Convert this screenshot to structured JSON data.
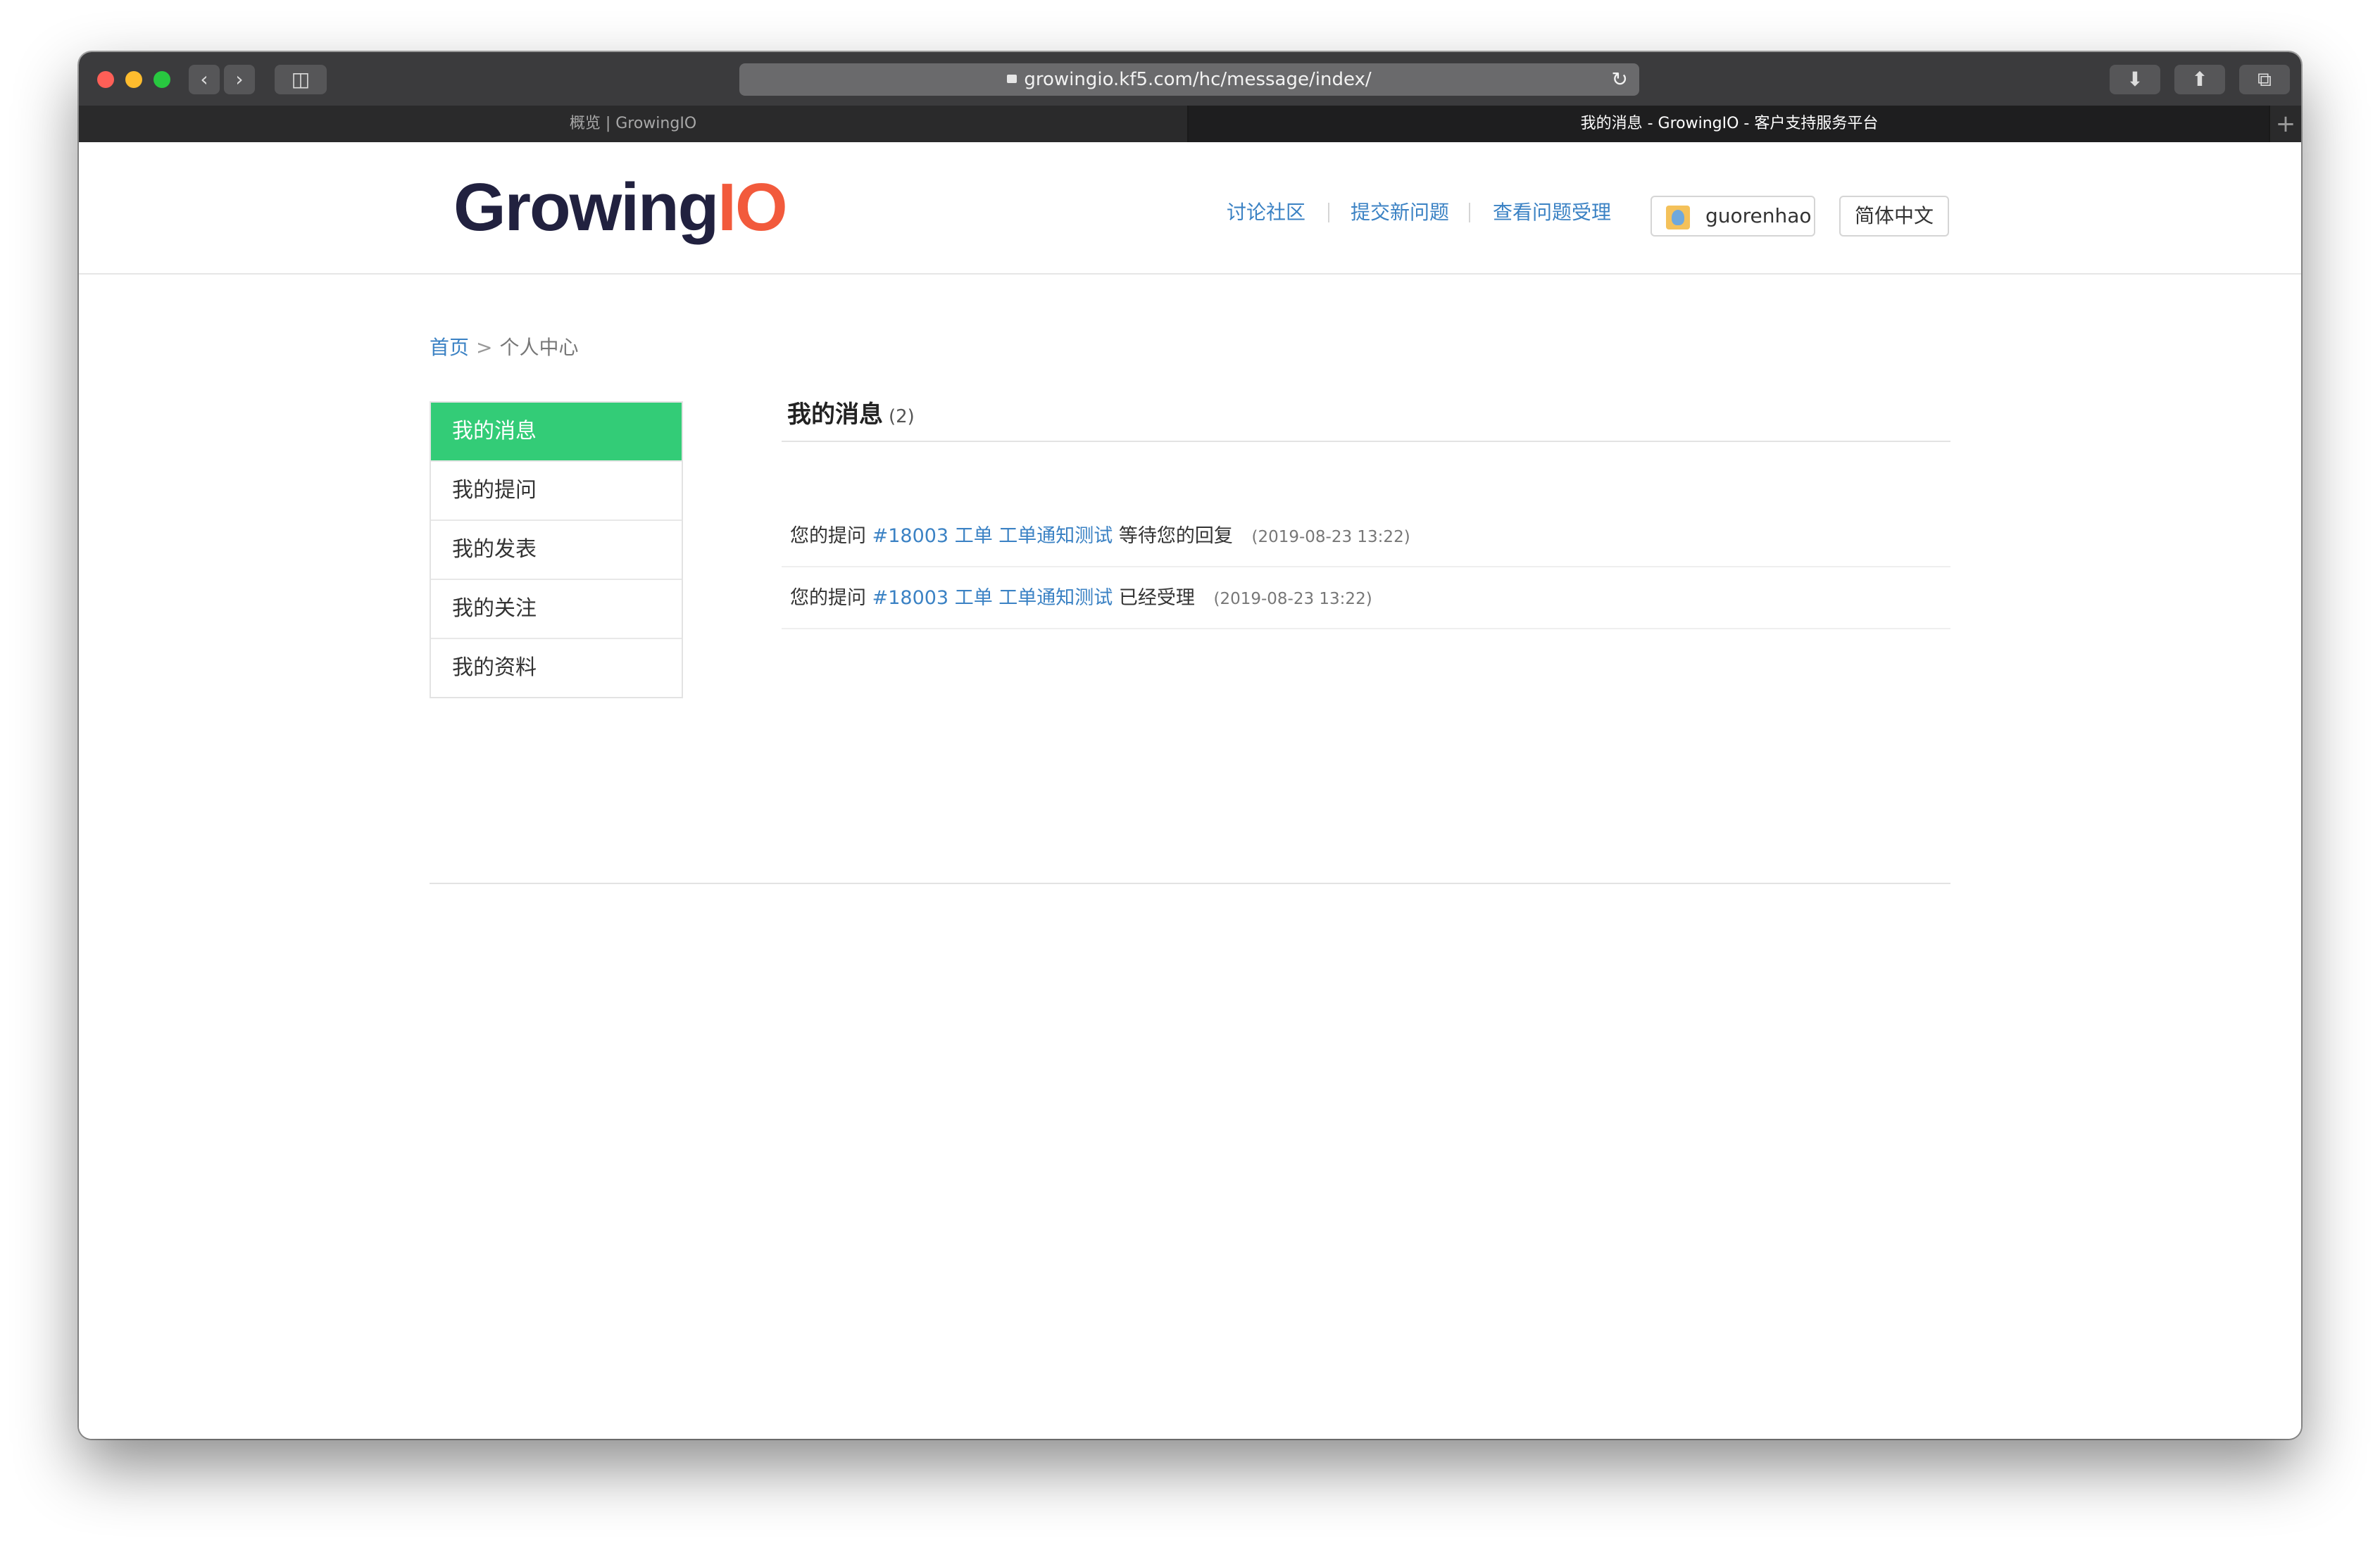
{
  "browser": {
    "url": "growingio.kf5.com/hc/message/index/",
    "tabs": [
      {
        "label": "概览 | GrowingIO",
        "active": false
      },
      {
        "label": "我的消息 - GrowingIO - 客户支持服务平台",
        "active": true
      }
    ],
    "new_tab": "+"
  },
  "header": {
    "logo_main": "Growing",
    "logo_accent": "IO",
    "nav": [
      "讨论社区",
      "提交新问题",
      "查看问题受理"
    ],
    "user": "guorenhao",
    "language": "简体中文"
  },
  "breadcrumb": {
    "home": "首页",
    "separator": ">",
    "current": "个人中心"
  },
  "sidebar": {
    "items": [
      {
        "label": "我的消息",
        "active": true
      },
      {
        "label": "我的提问",
        "active": false
      },
      {
        "label": "我的发表",
        "active": false
      },
      {
        "label": "我的关注",
        "active": false
      },
      {
        "label": "我的资料",
        "active": false
      }
    ]
  },
  "main": {
    "title": "我的消息",
    "count": "(2)",
    "messages": [
      {
        "prefix": "您的提问",
        "link": "#18003 工单 工单通知测试",
        "status": "等待您的回复",
        "time": "(2019-08-23 13:22)"
      },
      {
        "prefix": "您的提问",
        "link": "#18003 工单 工单通知测试",
        "status": "已经受理",
        "time": "(2019-08-23 13:22)"
      }
    ]
  },
  "colors": {
    "accent_green": "#33cc77",
    "link_blue": "#3b82c4",
    "logo_dark": "#21213f",
    "logo_orange": "#f25a3c"
  }
}
